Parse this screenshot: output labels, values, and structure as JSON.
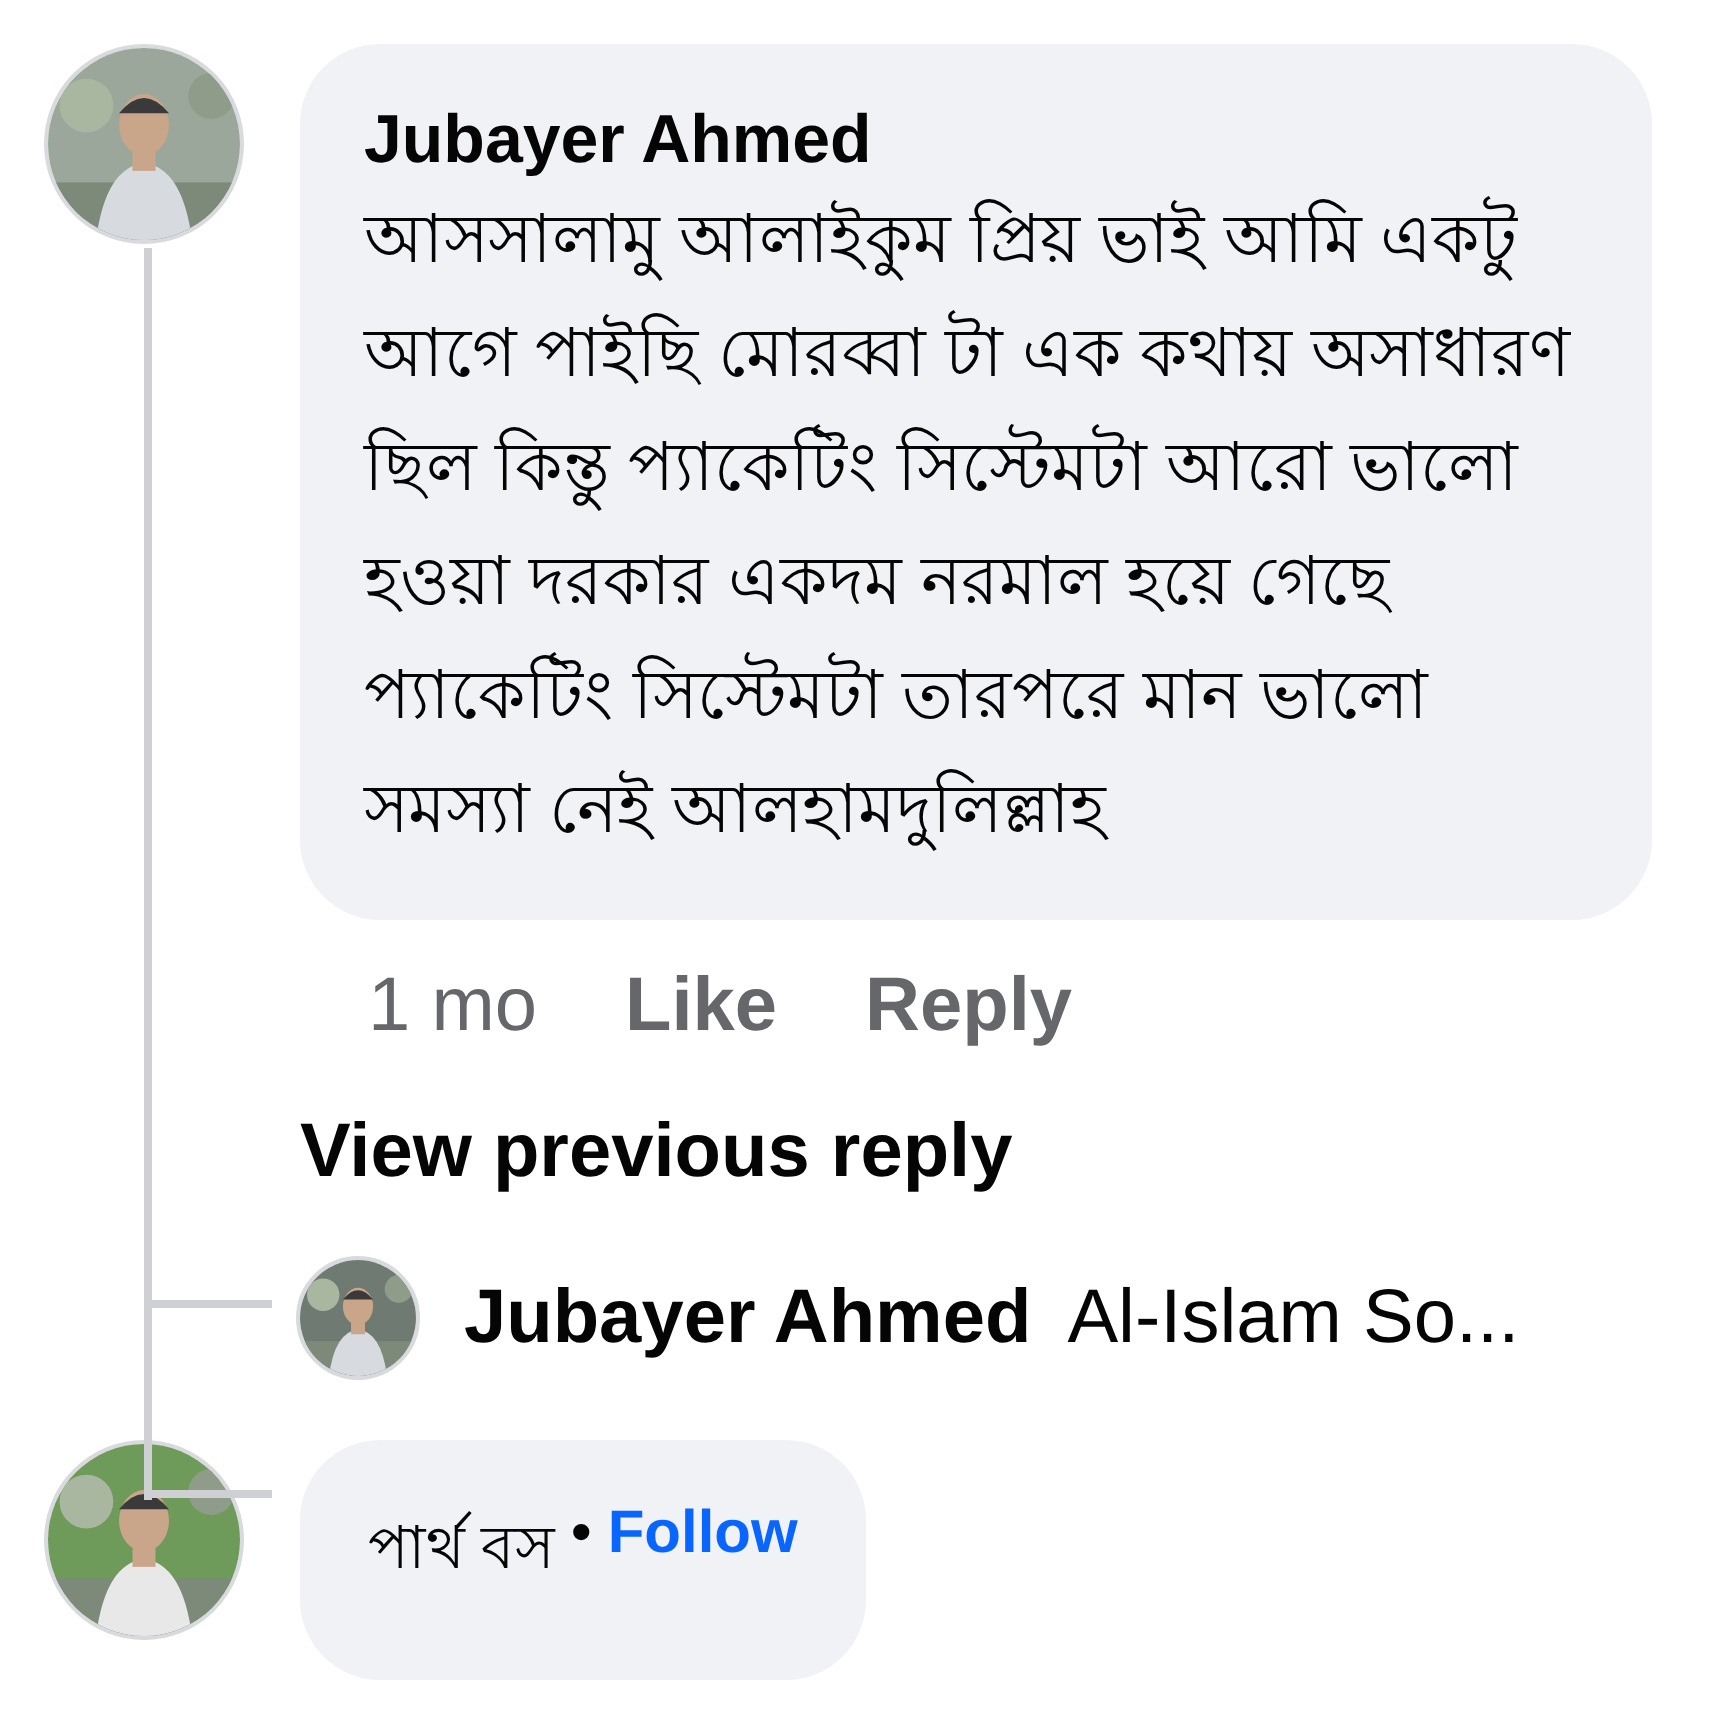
{
  "comment": {
    "author": "Jubayer Ahmed",
    "text": "আসসালামু আলাইকুম প্রিয় ভাই আমি একটু আগে পাইছি মোরব্বা টা এক কথায় অসাধারণ ছিল কিন্তু প্যাকেটিং সিস্টেমটা আরো ভালো হওয়া দরকার একদম নরমাল হয়ে গেছে প্যাকেটিং সিস্টেমটা তারপরে মান ভালো সমস্যা নেই আলহামদুলিল্লাহ",
    "time": "1 mo",
    "actions": [
      "Like",
      "Reply"
    ]
  },
  "view_previous": "View previous reply",
  "reply": {
    "author": "Jubayer Ahmed",
    "text": "Al-Islam So..."
  },
  "next_comment": {
    "author": "পার্থ বস",
    "separator": "•",
    "follow": "Follow"
  }
}
